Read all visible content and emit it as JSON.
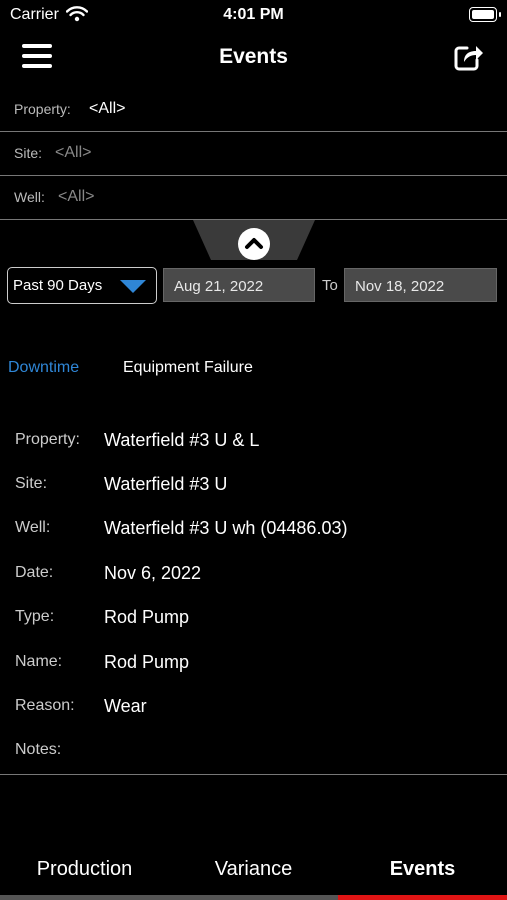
{
  "status_bar": {
    "carrier": "Carrier",
    "time": "4:01 PM"
  },
  "nav": {
    "title": "Events"
  },
  "filters": [
    {
      "label": "Property:",
      "value": "<All>"
    },
    {
      "label": "Site:",
      "value": "<All>"
    },
    {
      "label": "Well:",
      "value": "<All>"
    }
  ],
  "date_filter": {
    "range": "Past 90 Days",
    "from": "Aug 21, 2022",
    "to_label": "To",
    "to": "Nov 18, 2022"
  },
  "segments": [
    {
      "label": "Downtime",
      "selected": true
    },
    {
      "label": "Equipment Failure",
      "selected": false
    }
  ],
  "details": [
    {
      "label": "Property:",
      "value": "Waterfield #3 U & L"
    },
    {
      "label": "Site:",
      "value": "Waterfield #3 U"
    },
    {
      "label": "Well:",
      "value": "Waterfield #3 U wh (04486.03)"
    },
    {
      "label": "Date:",
      "value": "Nov 6, 2022"
    },
    {
      "label": "Type:",
      "value": "Rod Pump"
    },
    {
      "label": "Name:",
      "value": "Rod Pump"
    },
    {
      "label": "Reason:",
      "value": "Wear"
    },
    {
      "label": "Notes:",
      "value": ""
    }
  ],
  "tabs": [
    {
      "label": "Production"
    },
    {
      "label": "Variance"
    },
    {
      "label": "Events"
    }
  ],
  "active_tab": "Events",
  "colors": {
    "accent": "#2f86d6",
    "tab_indicator": "#e01414",
    "background": "#000000"
  },
  "icons": [
    "wifi-icon",
    "battery-icon",
    "hamburger-menu-icon",
    "share-icon",
    "chevron-up-icon",
    "dropdown-caret-icon"
  ]
}
